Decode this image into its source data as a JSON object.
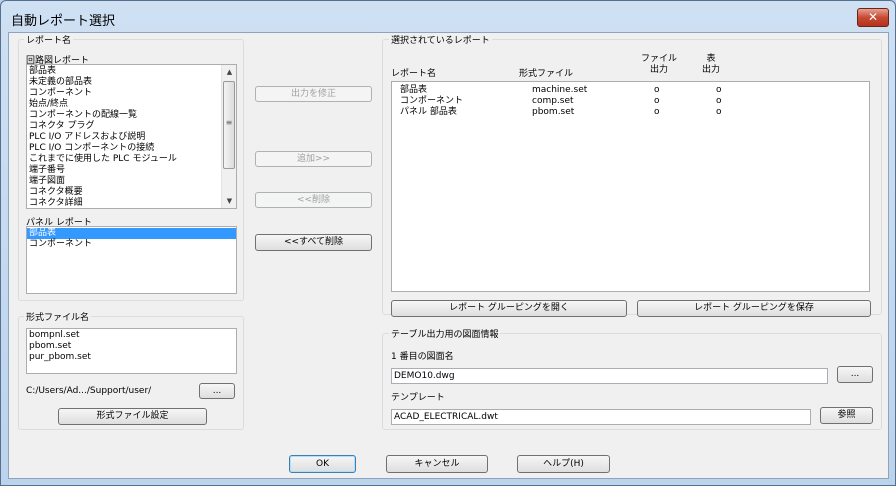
{
  "window": {
    "title": "自動レポート選択",
    "close_glyph": "✕"
  },
  "left": {
    "legend": "レポート名",
    "schematic_label": "回路図レポート",
    "schematic_items": [
      "部品表",
      "未定義の部品表",
      "コンポーネント",
      "始点/終点",
      "コンポーネントの配線一覧",
      "コネクタ プラグ",
      "PLC I/O アドレスおよび説明",
      "PLC I/O コンポーネントの接続",
      "これまでに使用した PLC モジュール",
      "端子番号",
      "端子図面",
      "コネクタ概要",
      "コネクタ詳細"
    ],
    "panel_label": "パネル レポート",
    "panel_items": [
      "部品表",
      "コンポーネント"
    ],
    "panel_selected_index": 0
  },
  "format": {
    "legend": "形式ファイル名",
    "items": [
      "bompnl.set",
      "pbom.set",
      "pur_pbom.set"
    ],
    "path": "C:/Users/Ad.../Support/user/",
    "browse_label": "...",
    "settings_label": "形式ファイル設定"
  },
  "middle": {
    "edit_output_label": "出力を修正",
    "add_label": "追加>>",
    "remove_label": "<<削除",
    "remove_all_label": "<<すべて削除"
  },
  "selected": {
    "legend": "選択されているレポート",
    "col_name": "レポート名",
    "col_format": "形式ファイル",
    "col_file_out": "ファイル\n出力",
    "col_table_out": "表\n出力",
    "rows": [
      {
        "name": "部品表",
        "format": "machine.set",
        "file": "o",
        "table": "o"
      },
      {
        "name": "コンポーネント",
        "format": "comp.set",
        "file": "o",
        "table": "o"
      },
      {
        "name": "パネル 部品表",
        "format": "pbom.set",
        "file": "o",
        "table": "o"
      }
    ],
    "open_group_label": "レポート グルーピングを開く",
    "save_group_label": "レポート グルーピングを保存"
  },
  "table_info": {
    "legend": "テーブル出力用の図面情報",
    "drawing_label": "1 番目の図面名",
    "drawing_value": "DEMO10.dwg",
    "drawing_browse_label": "...",
    "template_label": "テンプレート",
    "template_value": "ACAD_ELECTRICAL.dwt",
    "template_browse_label": "参照"
  },
  "footer": {
    "ok_label": "OK",
    "cancel_label": "キャンセル",
    "help_label": "ヘルプ(H)"
  }
}
